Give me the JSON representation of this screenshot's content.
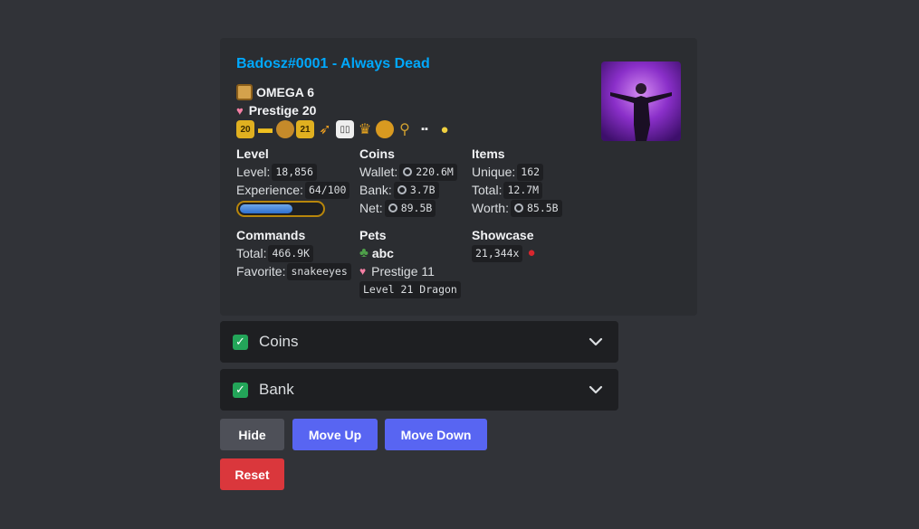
{
  "profile": {
    "title": "Badosz#0001 - Always Dead",
    "omega": "OMEGA 6",
    "prestige": "Prestige 20",
    "badge_numbers": [
      "20",
      "21"
    ]
  },
  "level": {
    "name": "Level",
    "level_label": "Level:",
    "level_value": "18,856",
    "exp_label": "Experience:",
    "exp_value": "64/100",
    "progress": 0.64
  },
  "coins": {
    "name": "Coins",
    "wallet_label": "Wallet:",
    "wallet_value": "220.6M",
    "bank_label": "Bank:",
    "bank_value": "3.7B",
    "net_label": "Net:",
    "net_value": "89.5B"
  },
  "items": {
    "name": "Items",
    "unique_label": "Unique:",
    "unique_value": "162",
    "total_label": "Total:",
    "total_value": "12.7M",
    "worth_label": "Worth:",
    "worth_value": "85.5B"
  },
  "commands": {
    "name": "Commands",
    "total_label": "Total:",
    "total_value": "466.9K",
    "fav_label": "Favorite:",
    "fav_value": "snakeeyes"
  },
  "pets": {
    "name": "Pets",
    "pet_name": "abc",
    "prestige": "Prestige 11",
    "level": "Level 21 Dragon"
  },
  "showcase": {
    "name": "Showcase",
    "count": "21,344x"
  },
  "accordions": [
    {
      "label": "Coins",
      "checked": true
    },
    {
      "label": "Bank",
      "checked": true
    }
  ],
  "buttons": {
    "hide": "Hide",
    "move_up": "Move Up",
    "move_down": "Move Down",
    "reset": "Reset"
  },
  "colors": {
    "background": "#313338",
    "embed": "#2b2d31",
    "title": "#00a8fc",
    "blurple": "#5865f2",
    "danger": "#da373c",
    "secondary": "#4e5058",
    "checkbox": "#23a559"
  },
  "icons": [
    "omega-avatar-icon",
    "prestige-heart-icon",
    "coin-icon",
    "pet-icon",
    "apple-icon",
    "chevron-down-icon",
    "checkbox-icon"
  ]
}
